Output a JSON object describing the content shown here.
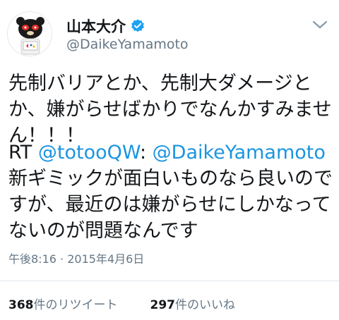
{
  "user": {
    "display_name": "山本大介",
    "handle": "@DaikeYamamoto",
    "verified_icon": "verified-badge-icon",
    "avatar_icon": "bear-mascot-avatar"
  },
  "tweet": {
    "body": "先制バリアとか、先制大ダメージとか、嫌がらせばかりでなんかすみません！！！",
    "rt_prefix": "RT ",
    "rt_mention": "@totooQW",
    "rt_colon": ": ",
    "rt_mention2": "@DaikeYamamoto",
    "rt_text": " 新ギミックが面白いものなら良いのですが、最近のは嫌がらせにしかなってないのが問題なんです"
  },
  "meta": {
    "time": "午後8:16",
    "separator": " · ",
    "date": "2015年4月6日"
  },
  "stats": {
    "retweets_count": "368",
    "retweets_label": "件のリツイート",
    "likes_count": "297",
    "likes_label": "件のいいね"
  },
  "colors": {
    "link": "#1b95e0",
    "secondary": "#657786",
    "verified": "#1da1f2"
  }
}
